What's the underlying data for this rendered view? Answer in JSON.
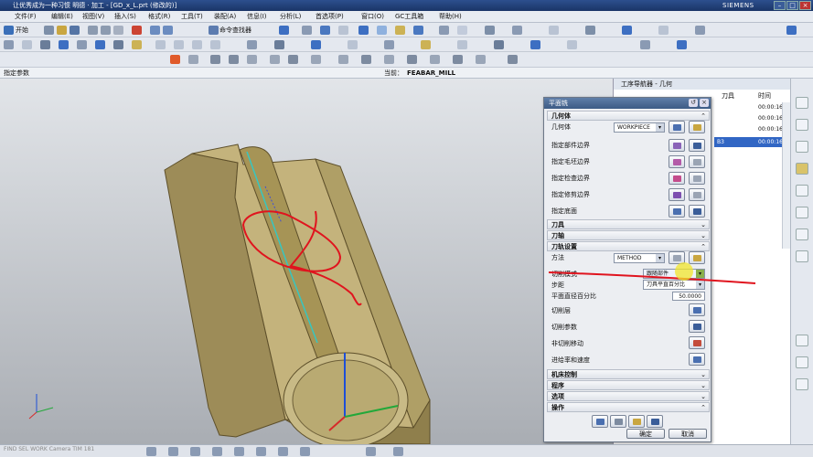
{
  "title_bar": {
    "title": "让优秀成为一种习惯 明德 · 加工 - [GD_x_L.prt (修改的)]",
    "brand": "SIEMENS"
  },
  "menu": {
    "items": [
      "文件(F)",
      "编辑(E)",
      "视图(V)",
      "插入(S)",
      "格式(R)",
      "工具(T)",
      "装配(A)",
      "信息(I)",
      "分析(L)",
      "首选项(P)",
      "窗口(O)",
      "GC工具箱",
      "帮助(H)"
    ]
  },
  "toolbar": {
    "start_label": "开始",
    "view_list_label": "命令查找器"
  },
  "status": {
    "left_label": "指定参数",
    "current_label": "当前：",
    "current_value": "FEABAR_MILL"
  },
  "navigator": {
    "title": "工序导航器 - 几何",
    "col_tool": "刀具",
    "col_time": "时间",
    "rows": [
      {
        "tool": "",
        "time": "00:00:16"
      },
      {
        "tool": "",
        "time": "00:00:16"
      },
      {
        "tool": "",
        "time": "00:00:16"
      },
      {
        "tool": "B3",
        "time": "00:00:16"
      }
    ]
  },
  "dialog": {
    "title": "平面铣",
    "geometry_section": "几何体",
    "geometry_label": "几何体",
    "geometry_value": "WORKPIECE",
    "part_boundary": "指定部件边界",
    "blank_boundary": "指定毛坯边界",
    "check_boundary": "指定检查边界",
    "trim_boundary": "指定修剪边界",
    "floor": "指定底面",
    "tool_section": "刀具",
    "axis_section": "刀轴",
    "path_section": "刀轨设置",
    "method_label": "方法",
    "method_value": "METHOD",
    "cut_pattern_label": "切削模式",
    "cut_pattern_value": "跟随部件",
    "stepover_label": "步距",
    "stepover_value": "刀具平直百分比",
    "percent_label": "平面直径百分比",
    "percent_value": "50.0000",
    "cut_levels": "切削层",
    "cut_params": "切削参数",
    "non_cut": "非切削移动",
    "feeds": "进给率和速度",
    "machine_section": "机床控制",
    "program_section": "程序",
    "options_section": "选项",
    "actions_section": "操作",
    "ok_label": "确定",
    "cancel_label": "取消"
  },
  "bottom": {
    "status_text": "FIND SEL WORK Camera TIM 181"
  },
  "colors": {
    "part_face": "#c4b37c",
    "part_side": "#9d8c58",
    "annotation_red": "#e0141e",
    "toolpath_cyan": "#37c6c0",
    "title_blue": "#2d4f8e"
  }
}
